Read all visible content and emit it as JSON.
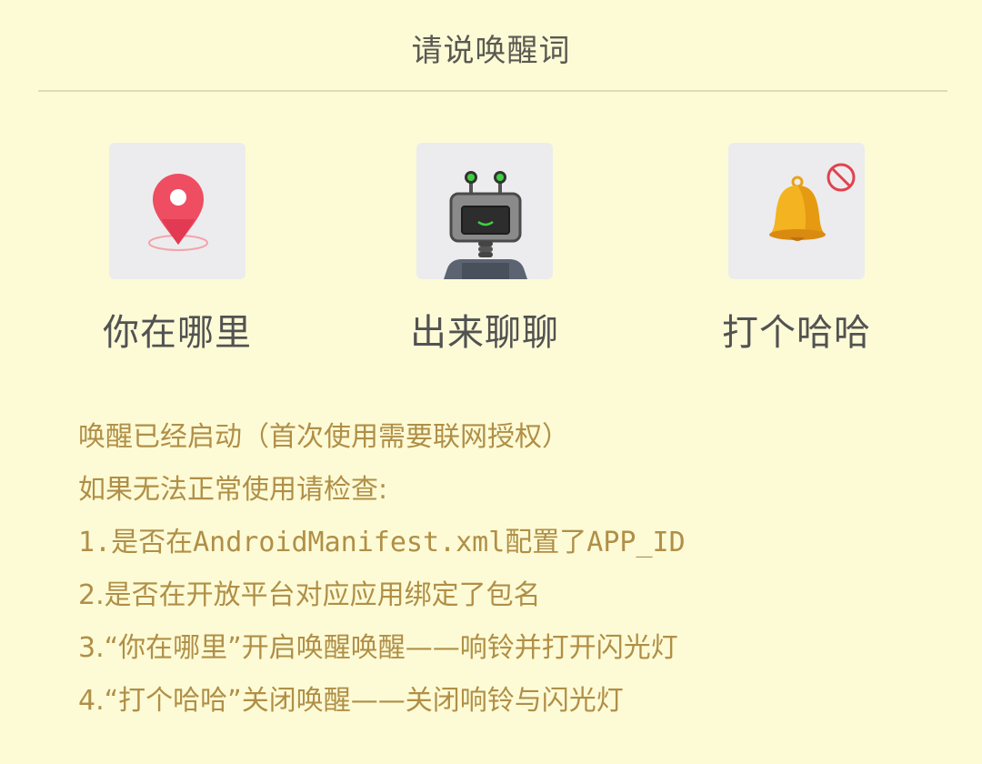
{
  "header": {
    "title": "请说唤醒词"
  },
  "commands": [
    {
      "label": "你在哪里",
      "icon": "location-pin-icon"
    },
    {
      "label": "出来聊聊",
      "icon": "robot-icon"
    },
    {
      "label": "打个哈哈",
      "icon": "bell-muted-icon"
    }
  ],
  "info": {
    "lines": [
      "唤醒已经启动（首次使用需要联网授权）",
      "如果无法正常使用请检查:",
      "1.是否在AndroidManifest.xml配置了APP_ID",
      "2.是否在开放平台对应应用绑定了包名",
      "3.“你在哪里”开启唤醒唤醒——响铃并打开闪光灯",
      "4.“打个哈哈”关闭唤醒——关闭响铃与闪光灯"
    ]
  },
  "colors": {
    "background": "#fdfbd6",
    "info_text": "#b08f47",
    "label_text": "#525252",
    "tile": "#ececee"
  }
}
